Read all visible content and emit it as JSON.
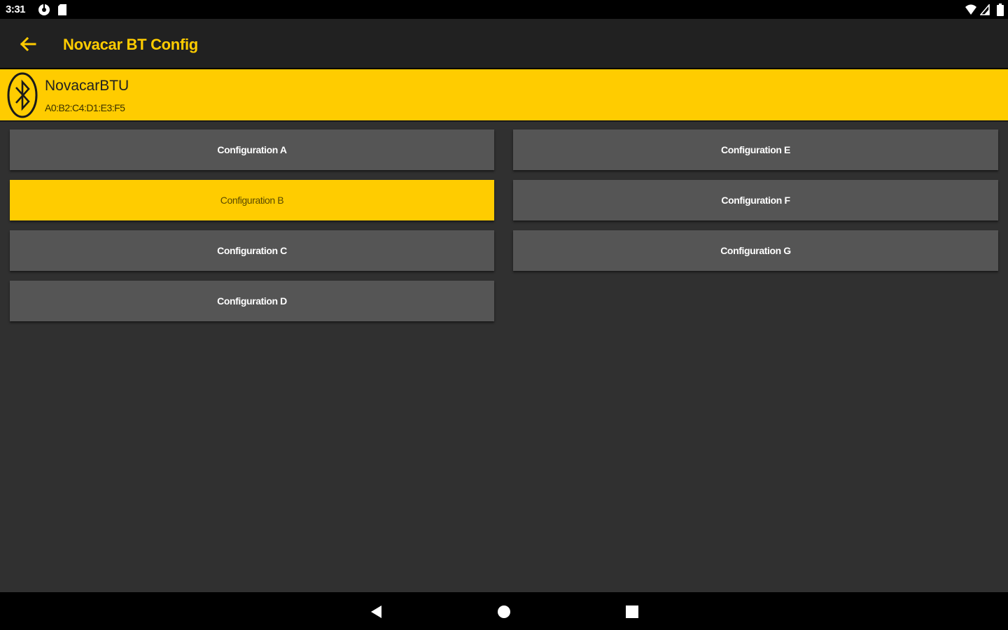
{
  "status_bar": {
    "time": "3:31",
    "left_icons": [
      "settings-icon",
      "sd-card-icon"
    ],
    "right_icons": [
      "wifi-icon",
      "cell-signal-icon",
      "battery-icon"
    ]
  },
  "app_bar": {
    "title": "Novacar BT Config",
    "back_icon": "arrow-left-icon"
  },
  "device": {
    "name": "NovacarBTU",
    "address": "A0:B2:C4:D1:E3:F5",
    "icon": "bluetooth-icon"
  },
  "configurations": {
    "left": [
      {
        "label": "Configuration A",
        "selected": false
      },
      {
        "label": "Configuration B",
        "selected": true
      },
      {
        "label": "Configuration C",
        "selected": false
      },
      {
        "label": "Configuration D",
        "selected": false
      }
    ],
    "right": [
      {
        "label": "Configuration E",
        "selected": false
      },
      {
        "label": "Configuration F",
        "selected": false
      },
      {
        "label": "Configuration G",
        "selected": false
      }
    ]
  },
  "nav_bar": {
    "buttons": [
      "back-triangle-icon",
      "home-circle-icon",
      "recents-square-icon"
    ]
  },
  "colors": {
    "accent": "#ffcc00",
    "background": "#303030",
    "app_bar": "#212121",
    "button": "#555555"
  }
}
